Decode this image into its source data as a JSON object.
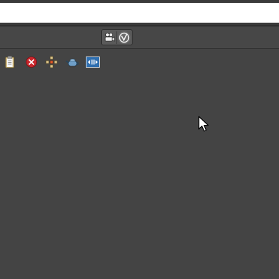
{
  "window": {
    "title_bar_text": ""
  },
  "mode_bar": {
    "buttons": [
      {
        "icon": "film-camera-icon"
      },
      {
        "icon": "vertex-mode-icon"
      }
    ]
  },
  "toolbar": {
    "tools": [
      {
        "icon": "clipboard-icon"
      },
      {
        "icon": "close-icon"
      },
      {
        "icon": "grid-layout-icon"
      },
      {
        "icon": "teapot-icon"
      },
      {
        "icon": "video-timeline-icon"
      }
    ]
  },
  "colors": {
    "background": "#444444",
    "top_strip": "#ffffff",
    "close_red": "#c8262c",
    "timeline_blue": "#2f6fb0"
  }
}
